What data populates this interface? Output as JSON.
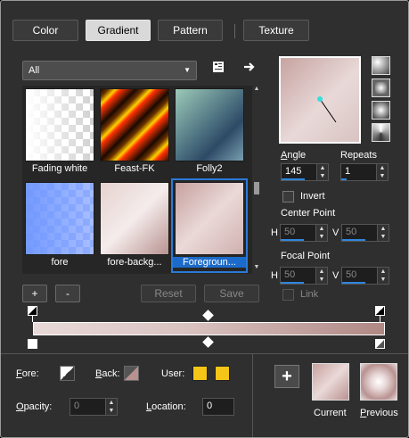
{
  "tabs": [
    {
      "label": "Color",
      "active": false
    },
    {
      "label": "Gradient",
      "active": true
    },
    {
      "label": "Pattern",
      "active": false
    },
    {
      "label": "Texture",
      "active": false
    }
  ],
  "category": {
    "selected": "All"
  },
  "gradients": [
    {
      "name": "Fading white",
      "selected": false
    },
    {
      "name": "Feast-FK",
      "selected": false
    },
    {
      "name": "Folly2",
      "selected": false
    },
    {
      "name": "fore",
      "selected": false
    },
    {
      "name": "fore-backg...",
      "selected": false
    },
    {
      "name": "Foregroun...",
      "selected": true
    }
  ],
  "buttons": {
    "add": "+",
    "remove": "-",
    "reset": "Reset",
    "save": "Save"
  },
  "angle": {
    "label": "Angle",
    "value": "145"
  },
  "repeats": {
    "label": "Repeats",
    "value": "1"
  },
  "invert": {
    "label": "Invert",
    "checked": false
  },
  "center_point": {
    "label": "Center Point",
    "h_label": "H",
    "h_value": "50",
    "v_label": "V",
    "v_value": "50"
  },
  "focal_point": {
    "label": "Focal Point",
    "h_label": "H",
    "h_value": "50",
    "v_label": "V",
    "v_value": "50"
  },
  "link": {
    "label": "Link"
  },
  "footer": {
    "fore_label": "Fore:",
    "back_label": "Back:",
    "user_label": "User:",
    "opacity_label": "Opacity:",
    "opacity_value": "0",
    "location_label": "Location:",
    "location_value": "0",
    "current_label": "Current",
    "previous_label": "Previous"
  },
  "colors": {
    "user1": "#f5c518",
    "user2": "#f5c518",
    "selection": "#1c6ac9",
    "accent_bar": "#2e86de"
  }
}
